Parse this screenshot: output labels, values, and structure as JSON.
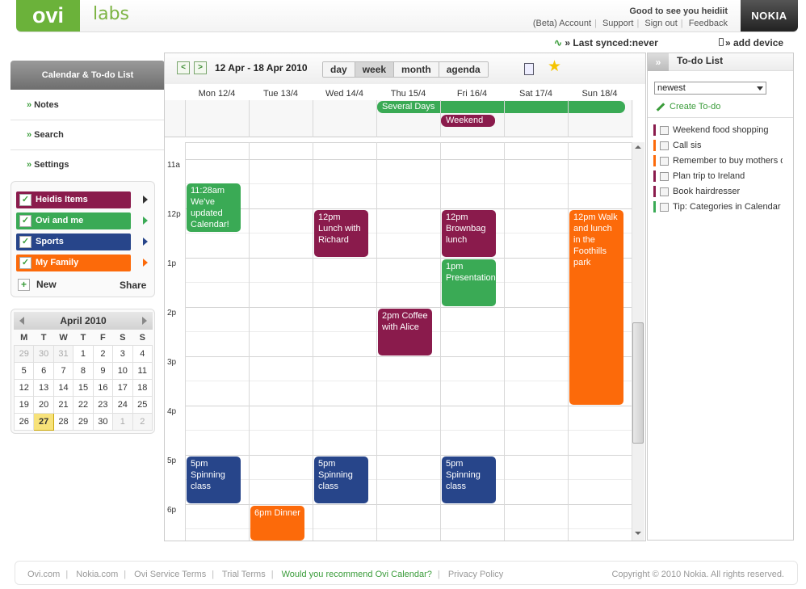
{
  "header": {
    "logo": "ovi",
    "labs": "labs",
    "greeting": "Good to see you heidiit",
    "links": [
      "(Beta) Account",
      "Support",
      "Sign out",
      "Feedback"
    ],
    "nokia": "NOKIA",
    "sync_label": "» Last synced:never",
    "add_device": "» add device"
  },
  "sidebar": {
    "title": "Calendar & To-do List",
    "items": [
      {
        "label": "Notes"
      },
      {
        "label": "Search"
      },
      {
        "label": "Settings"
      }
    ],
    "categories": [
      {
        "label": "Heidis Items",
        "color": "#8a1b4c"
      },
      {
        "label": "Ovi and me",
        "color": "#3aaa55"
      },
      {
        "label": "Sports",
        "color": "#27458a"
      },
      {
        "label": "My Family",
        "color": "#fc6a0a"
      }
    ],
    "new_label": "New",
    "share_label": "Share"
  },
  "minical": {
    "month": "April 2010",
    "weekdays": [
      "M",
      "T",
      "W",
      "T",
      "F",
      "S",
      "S"
    ],
    "weeks": [
      [
        "29",
        "30",
        "31",
        "1",
        "2",
        "3",
        "4"
      ],
      [
        "5",
        "6",
        "7",
        "8",
        "9",
        "10",
        "11"
      ],
      [
        "12",
        "13",
        "14",
        "15",
        "16",
        "17",
        "18"
      ],
      [
        "19",
        "20",
        "21",
        "22",
        "23",
        "24",
        "25"
      ],
      [
        "26",
        "27",
        "28",
        "29",
        "30",
        "1",
        "2"
      ]
    ],
    "today": "27"
  },
  "calendar": {
    "date_range": "12 Apr - 18 Apr 2010",
    "views": [
      {
        "label": "day"
      },
      {
        "label": "week",
        "active": true
      },
      {
        "label": "month"
      },
      {
        "label": "agenda"
      }
    ],
    "days": [
      "Mon 12/4",
      "Tue 13/4",
      "Wed 14/4",
      "Thu 15/4",
      "Fri 16/4",
      "Sat 17/4",
      "Sun 18/4"
    ],
    "hours": [
      "11a",
      "12p",
      "1p",
      "2p",
      "3p",
      "4p",
      "5p",
      "6p"
    ],
    "allday": [
      {
        "title": "Several Days",
        "color": "#3aaa55"
      },
      {
        "title": "Weekend",
        "color": "#8a1b4c"
      }
    ],
    "events": [
      {
        "text": "11:28am We've updated Calendar!",
        "day": "Mon 12/4",
        "start": "11:28",
        "end": "12:30",
        "category": "Ovi and me"
      },
      {
        "text": "12pm Lunch with Richard",
        "day": "Wed 14/4",
        "start": "12:00",
        "end": "13:00",
        "category": "Heidis Items"
      },
      {
        "text": "12pm Brownbag lunch",
        "day": "Fri 16/4",
        "start": "12:00",
        "end": "13:00",
        "category": "Heidis Items"
      },
      {
        "text": "12pm Walk and lunch in the Foothills park",
        "day": "Sun 18/4",
        "start": "12:00",
        "end": "16:00",
        "category": "My Family"
      },
      {
        "text": "1pm Presentation",
        "day": "Fri 16/4",
        "start": "13:00",
        "end": "14:00",
        "category": "Ovi and me"
      },
      {
        "text": "2pm Coffee with Alice",
        "day": "Thu 15/4",
        "start": "14:00",
        "end": "15:00",
        "category": "Heidis Items"
      },
      {
        "text": "5pm Spinning class",
        "day": "Mon 12/4",
        "start": "17:00",
        "end": "18:00",
        "category": "Sports"
      },
      {
        "text": "5pm Spinning class",
        "day": "Wed 14/4",
        "start": "17:00",
        "end": "18:00",
        "category": "Sports"
      },
      {
        "text": "5pm Spinning class",
        "day": "Fri 16/4",
        "start": "17:00",
        "end": "18:00",
        "category": "Sports"
      },
      {
        "text": "6pm Dinner",
        "day": "Tue 13/4",
        "start": "18:00",
        "end": "19:00",
        "category": "My Family"
      }
    ]
  },
  "todo": {
    "title": "To-do List",
    "sort": "newest",
    "create_label": "Create To-do",
    "items": [
      {
        "label": "Weekend food shopping",
        "color": "#8a1b4c"
      },
      {
        "label": "Call sis",
        "color": "#fc6a0a"
      },
      {
        "label": "Remember to buy mothers d",
        "color": "#fc6a0a"
      },
      {
        "label": "Plan trip to Ireland",
        "color": "#8a1b4c"
      },
      {
        "label": "Book hairdresser",
        "color": "#8a1b4c"
      },
      {
        "label": "Tip: Categories in Calendar (",
        "color": "#3aaa55"
      }
    ]
  },
  "footer": {
    "links": [
      "Ovi.com",
      "Nokia.com",
      "Ovi Service Terms",
      "Trial Terms",
      "Would you recommend Ovi Calendar?",
      "Privacy Policy"
    ],
    "copyright": "Copyright © 2010 Nokia. All rights reserved."
  }
}
